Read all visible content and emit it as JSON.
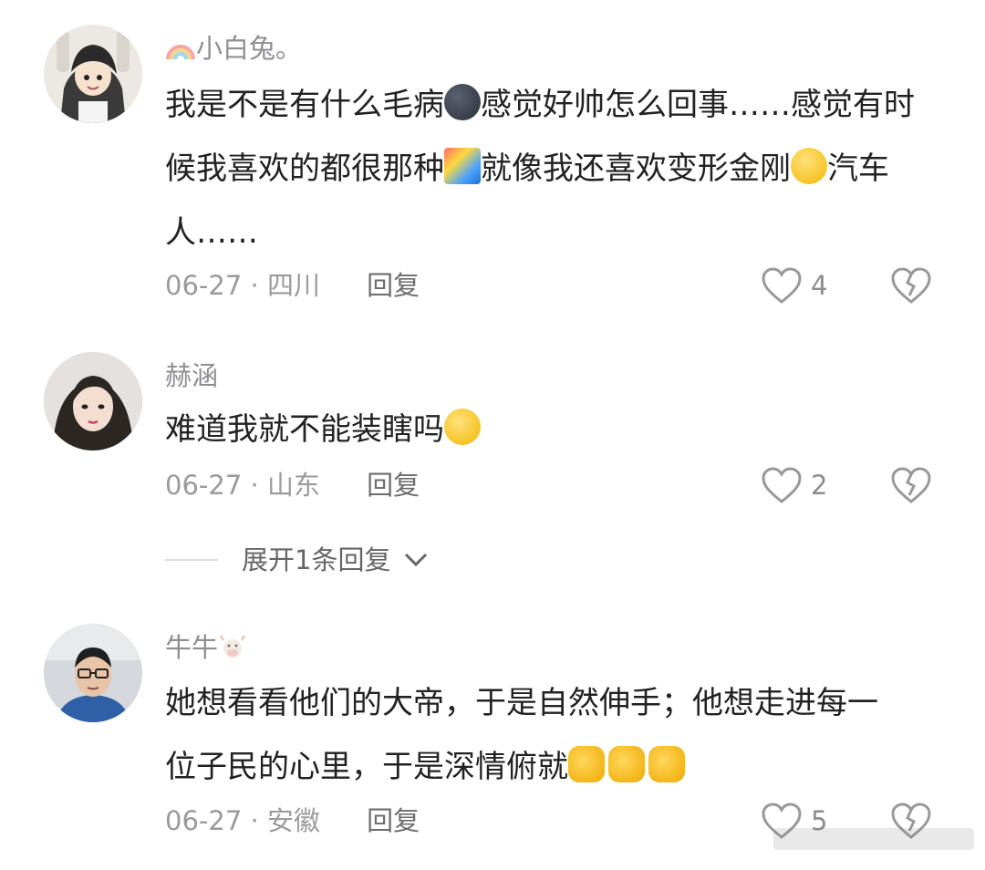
{
  "comments": [
    {
      "username": "小白兔。",
      "username_prefix_icon": "rainbow-icon",
      "text_lines": [
        [
          "我是不是有什么毛病",
          "🌑",
          "感觉好帅怎么回事……感觉有时"
        ],
        [
          "候我喜欢的都很那种",
          "🌈",
          "就像我还喜欢变形金刚",
          "🙂",
          "汽车"
        ],
        [
          "人……"
        ]
      ],
      "date": "06-27",
      "location": "四川",
      "reply_label": "回复",
      "likes": "4"
    },
    {
      "username": "赫涵",
      "text_lines": [
        [
          "难道我就不能装瞎吗",
          "🤣"
        ]
      ],
      "date": "06-27",
      "location": "山东",
      "reply_label": "回复",
      "likes": "2"
    },
    {
      "username": "牛牛",
      "username_suffix_icon": "cow-icon",
      "text_lines": [
        [
          "她想看看他们的大帝，于是自然伸手；他想走进每一"
        ],
        [
          "位子民的心里，于是深情俯就",
          "👏",
          "👏",
          "👏"
        ]
      ],
      "date": "06-27",
      "location": "安徽",
      "reply_label": "回复",
      "likes": "5"
    }
  ],
  "expand_replies": {
    "label": "展开1条回复"
  },
  "meta_separator": "·",
  "colors": {
    "text": "#222222",
    "username": "#8e8e93",
    "meta": "#9b9b9b",
    "icon": "#999999"
  }
}
